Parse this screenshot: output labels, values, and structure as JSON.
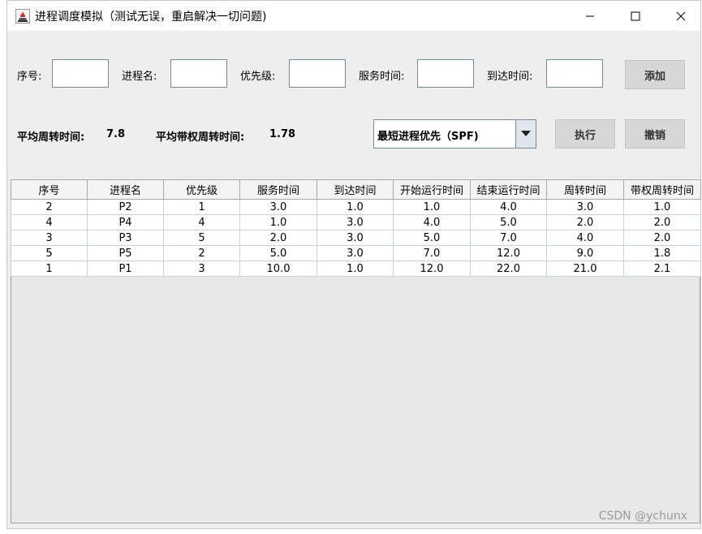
{
  "window": {
    "title": "进程调度模拟（测试无误，重启解决一切问题)"
  },
  "form": {
    "seq_label": "序号:",
    "name_label": "进程名:",
    "priority_label": "优先级:",
    "service_label": "服务时间:",
    "arrival_label": "到达时间:",
    "seq_value": "",
    "name_value": "",
    "priority_value": "",
    "service_value": "",
    "arrival_value": "",
    "add_label": "添加"
  },
  "stats": {
    "avg_turnaround_label": "平均周转时间:",
    "avg_turnaround_value": "7.8",
    "avg_weighted_label": "平均带权周转时间:",
    "avg_weighted_value": "1.78"
  },
  "algorithm": {
    "selected": "最短进程优先（SPF)"
  },
  "actions": {
    "execute_label": "执行",
    "undo_label": "撤销"
  },
  "table": {
    "columns": [
      "序号",
      "进程名",
      "优先级",
      "服务时间",
      "到达时间",
      "开始运行时间",
      "结束运行时间",
      "周转时间",
      "带权周转时间"
    ],
    "rows": [
      [
        "2",
        "P2",
        "1",
        "3.0",
        "1.0",
        "1.0",
        "4.0",
        "3.0",
        "1.0"
      ],
      [
        "4",
        "P4",
        "4",
        "1.0",
        "3.0",
        "4.0",
        "5.0",
        "2.0",
        "2.0"
      ],
      [
        "3",
        "P3",
        "5",
        "2.0",
        "3.0",
        "5.0",
        "7.0",
        "4.0",
        "2.0"
      ],
      [
        "5",
        "P5",
        "2",
        "5.0",
        "3.0",
        "7.0",
        "12.0",
        "9.0",
        "1.8"
      ],
      [
        "1",
        "P1",
        "3",
        "10.0",
        "1.0",
        "12.0",
        "22.0",
        "21.0",
        "2.1"
      ]
    ]
  },
  "watermark": "CSDN @ychunx",
  "icons": {
    "app": "java-app-icon",
    "minimize": "minimize-icon",
    "maximize": "maximize-icon",
    "close": "close-icon",
    "dropdown": "dropdown-arrow-icon"
  }
}
